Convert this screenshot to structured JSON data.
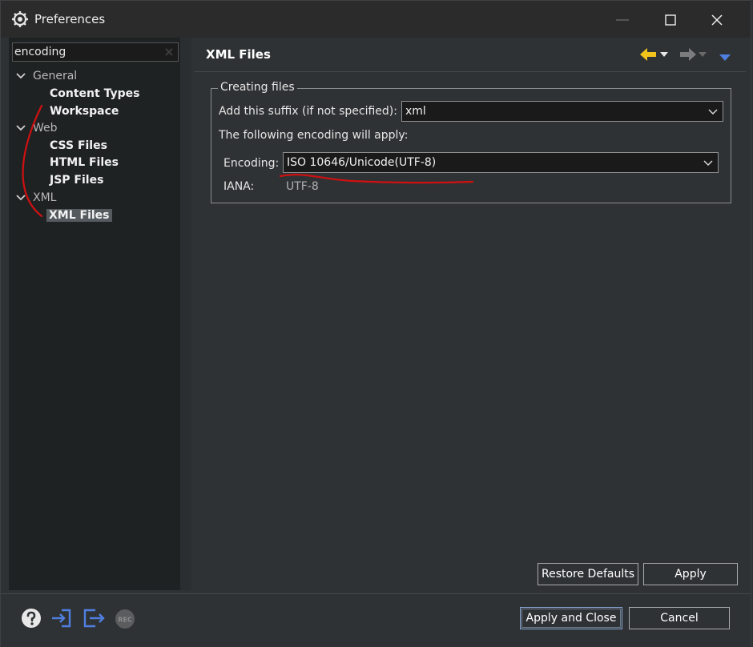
{
  "window": {
    "title": "Preferences",
    "icons": [
      "preferences-gear-icon",
      "minimize-icon",
      "maximize-icon",
      "close-icon"
    ]
  },
  "filter": {
    "value": "encoding",
    "icon": "clear-filter-icon"
  },
  "tree": {
    "categories": [
      {
        "label": "General",
        "children": [
          "Content Types",
          "Workspace"
        ]
      },
      {
        "label": "Web",
        "children": [
          "CSS Files",
          "HTML Files",
          "JSP Files"
        ]
      },
      {
        "label": "XML",
        "children": [
          "XML Files"
        ]
      }
    ],
    "selected": "XML Files"
  },
  "page": {
    "title": "XML Files",
    "nav_icons": [
      "back-arrow-icon",
      "forward-arrow-icon",
      "view-menu-icon"
    ]
  },
  "creating_files": {
    "legend": "Creating files",
    "suffix_label": "Add this suffix (if not specified):",
    "suffix_value": "xml",
    "info_text": "The following encoding will apply:",
    "encoding_label": "Encoding:",
    "encoding_value": "ISO 10646/Unicode(UTF-8)",
    "iana_label": "IANA:",
    "iana_value": "UTF-8"
  },
  "page_buttons": {
    "restore_defaults": "Restore Defaults",
    "apply": "Apply"
  },
  "footer_buttons": {
    "apply_and_close": "Apply and Close",
    "cancel": "Cancel",
    "icons": [
      "help-icon",
      "import-icon",
      "export-icon",
      "record-icon"
    ]
  },
  "colors": {
    "accent_blue": "#4f7fe0",
    "back_arrow": "#f2c31b",
    "annotation_red": "#d01010"
  }
}
